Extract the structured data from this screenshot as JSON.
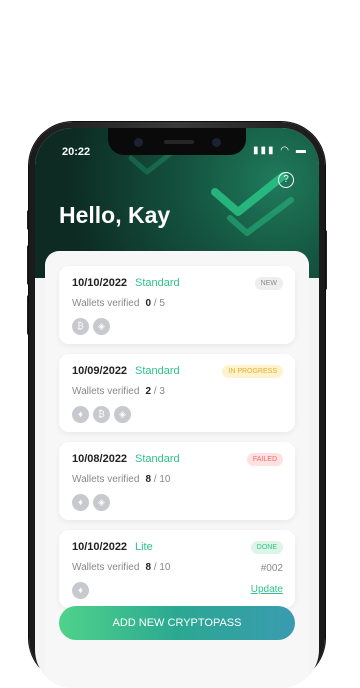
{
  "status": {
    "time": "20:22"
  },
  "header": {
    "greeting": "Hello, Kay"
  },
  "cards": [
    {
      "date": "10/10/2022",
      "plan": "Standard",
      "badge": "NEW",
      "label": "Wallets verified",
      "count": "0",
      "total": "/ 5",
      "ref": "",
      "action": ""
    },
    {
      "date": "10/09/2022",
      "plan": "Standard",
      "badge": "IN PROGRESS",
      "label": "Wallets verified",
      "count": "2",
      "total": "/ 3",
      "ref": "",
      "action": ""
    },
    {
      "date": "10/08/2022",
      "plan": "Standard",
      "badge": "FAILED",
      "label": "Wallets verified",
      "count": "8",
      "total": "/ 10",
      "ref": "",
      "action": ""
    },
    {
      "date": "10/10/2022",
      "plan": "Lite",
      "badge": "DONE",
      "label": "Wallets verified",
      "count": "8",
      "total": "/ 10",
      "ref": "#002",
      "action": "Update"
    }
  ],
  "cta": {
    "label": "ADD NEW CRYPTOPASS"
  }
}
